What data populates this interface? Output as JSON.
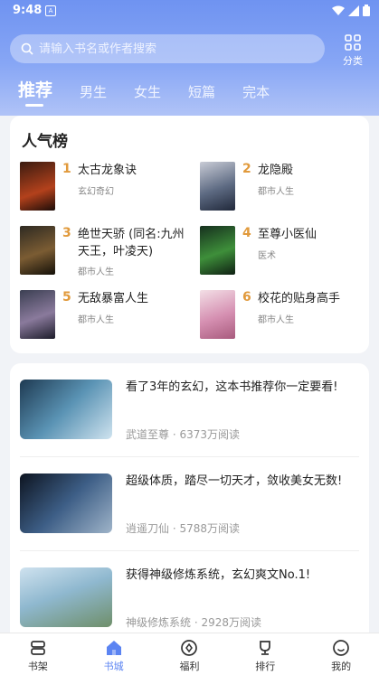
{
  "status": {
    "time": "9:48",
    "sim_label": "A"
  },
  "search": {
    "placeholder": "请输入书名或作者搜索"
  },
  "category": {
    "label": "分类"
  },
  "tabs": [
    {
      "label": "推荐"
    },
    {
      "label": "男生"
    },
    {
      "label": "女生"
    },
    {
      "label": "短篇"
    },
    {
      "label": "完本"
    }
  ],
  "ranking": {
    "title": "人气榜",
    "items": [
      {
        "rank": "1",
        "title": "太古龙象诀",
        "genre": "玄幻奇幻"
      },
      {
        "rank": "2",
        "title": "龙隐殿",
        "genre": "都市人生"
      },
      {
        "rank": "3",
        "title": "绝世天骄 (同名:九州天王，叶凌天)",
        "genre": "都市人生"
      },
      {
        "rank": "4",
        "title": "至尊小医仙",
        "genre": "医术"
      },
      {
        "rank": "5",
        "title": "无敌暴富人生",
        "genre": "都市人生"
      },
      {
        "rank": "6",
        "title": "校花的贴身高手",
        "genre": "都市人生"
      }
    ]
  },
  "feed": [
    {
      "title": "看了3年的玄幻，这本书推荐你一定要看!",
      "book": "武道至尊",
      "reads": "6373万阅读"
    },
    {
      "title": "超级体质，踏尽一切天才，敛收美女无数!",
      "book": "逍遥刀仙",
      "reads": "5788万阅读"
    },
    {
      "title": "获得神级修炼系统，玄幻爽文No.1!",
      "book": "神级修炼系统",
      "reads": "2928万阅读"
    }
  ],
  "meta_separator": "·",
  "nav": [
    {
      "label": "书架"
    },
    {
      "label": "书城"
    },
    {
      "label": "福利"
    },
    {
      "label": "排行"
    },
    {
      "label": "我的"
    }
  ],
  "colors": {
    "accent": "#5b84f2",
    "rank_number": "#e19a3c",
    "header_gradient_top": "#6f93f1"
  }
}
